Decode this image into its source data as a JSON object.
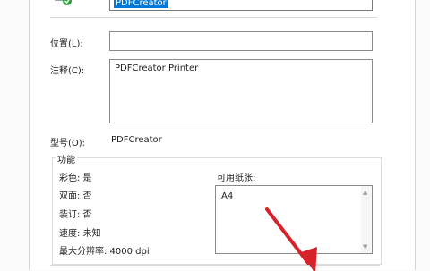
{
  "window": {
    "accent": "#0078d7",
    "arrow_color": "#d6232a"
  },
  "printer": {
    "name_selected": "PDFCreator"
  },
  "fields": {
    "location_label": "位置(L):",
    "location_value": "",
    "comment_label": "注释(C):",
    "comment_value": "PDFCreator Printer",
    "model_label": "型号(O):",
    "model_value": "PDFCreator"
  },
  "features": {
    "legend": "功能",
    "color": "彩色: 是",
    "duplex": "双面: 否",
    "staple": "装订: 否",
    "speed": "速度: 未知",
    "max_resolution": "最大分辨率: 4000 dpi",
    "paper_label": "可用纸张:",
    "paper_items": [
      "A4"
    ]
  },
  "icons": {
    "printer_status": "printer-check-icon",
    "scroll_up": "scroll-up-arrow-icon",
    "scroll_down": "scroll-down-arrow-icon"
  }
}
